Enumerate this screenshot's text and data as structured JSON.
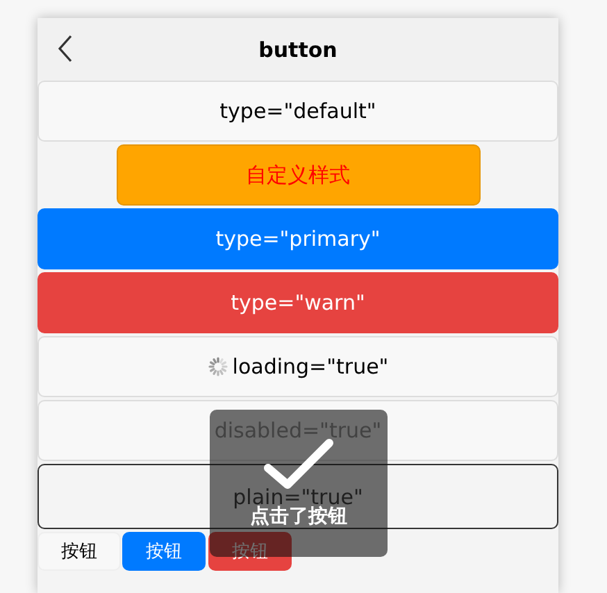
{
  "nav_bar": {
    "title": "button"
  },
  "buttons": [
    {
      "label": "type=\"default\"",
      "kind": "default",
      "disabled": false,
      "loading": false
    },
    {
      "label": "自定义样式",
      "kind": "custom",
      "disabled": false,
      "loading": false
    },
    {
      "label": "type=\"primary\"",
      "kind": "primary",
      "disabled": false,
      "loading": false
    },
    {
      "label": "type=\"warn\"",
      "kind": "warn",
      "disabled": false,
      "loading": false
    },
    {
      "label": "loading=\"true\"",
      "kind": "default",
      "disabled": false,
      "loading": true
    },
    {
      "label": "disabled=\"true\"",
      "kind": "default",
      "disabled": true,
      "loading": false
    },
    {
      "label": "plain=\"true\"",
      "kind": "plain",
      "disabled": false,
      "loading": false
    }
  ],
  "mini_buttons": [
    {
      "label": "按钮",
      "kind": "default"
    },
    {
      "label": "按钮",
      "kind": "primary"
    },
    {
      "label": "按钮",
      "kind": "warn"
    }
  ],
  "toast": {
    "text": "点击了按钮"
  }
}
